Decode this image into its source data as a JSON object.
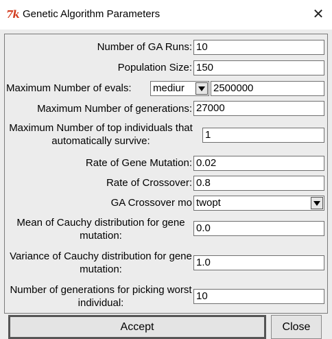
{
  "window": {
    "title": "Genetic Algorithm Parameters",
    "icon": "tk-icon",
    "close": "✕"
  },
  "fields": {
    "ga_runs": {
      "label": "Number of GA Runs:",
      "value": "10"
    },
    "population": {
      "label": "Population Size:",
      "value": "150"
    },
    "max_evals": {
      "label": "Maximum Number of evals:",
      "mode": "mediur",
      "value": "2500000"
    },
    "max_gens": {
      "label": "Maximum Number of generations:",
      "value": "27000"
    },
    "top_survive": {
      "label": "Maximum Number of top individuals that automatically survive:",
      "value": "1"
    },
    "mutation_rate": {
      "label": "Rate of Gene Mutation:",
      "value": "0.02"
    },
    "crossover_rate": {
      "label": "Rate of Crossover:",
      "value": "0.8"
    },
    "crossover_mode": {
      "label": "GA Crossover mo",
      "value": "twopt"
    },
    "cauchy_mean": {
      "label": "Mean of Cauchy distribution for gene mutation:",
      "value": "0.0"
    },
    "cauchy_var": {
      "label": "Variance of Cauchy distribution for gene mutation:",
      "value": "1.0"
    },
    "worst_gens": {
      "label": "Number of generations for picking worst individual:",
      "value": "10"
    }
  },
  "buttons": {
    "accept": "Accept",
    "close": "Close"
  }
}
